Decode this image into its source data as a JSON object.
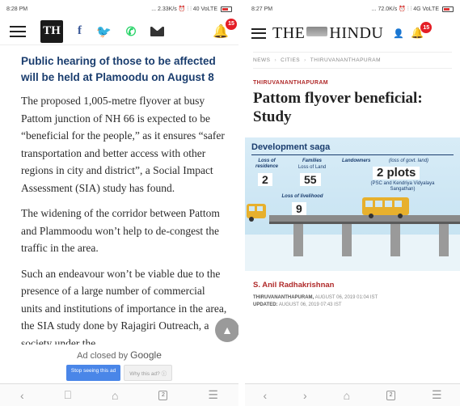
{
  "left": {
    "status": {
      "time": "8:28 PM",
      "right": "... 2.33K/s ⏰ ⫶ ⫶ 40 VoLTE"
    },
    "header": {
      "logo": "TH",
      "facebook": "f",
      "twitter": "🐦",
      "whatsapp": "✆",
      "notification_count": "15"
    },
    "headline": "Public hearing of those to be affected will be held at Plamoodu on August 8",
    "paragraphs": [
      "The proposed 1,005-metre flyover at busy Pattom junction of NH 66 is expected to be “beneficial for the people,” as it ensures “safer transportation and better access with other regions in city and district”, a Social Impact Assessment (SIA) study has found.",
      "The widening of the corridor between Pattom and Plammoodu won’t help to de-congest the traffic in the area.",
      "Such an endeavour won’t be viable due to the presence of a large number of commercial units and institutions of importance in the area, the SIA study done by Rajagiri Outreach, a society under the"
    ],
    "ad": {
      "closed_by": "Ad closed by",
      "google": "Google",
      "stop_label": "Stop seeing this ad",
      "why_label": "Why this ad? ⓘ"
    },
    "nav": {
      "back": "‹",
      "book": "⎕",
      "home": "⌂",
      "tabs": "2",
      "menu": "☰"
    }
  },
  "right": {
    "status": {
      "time": "8:27 PM",
      "right": "... 72.0K/s ⏰ ⫶ ⫶ 4G VoLTE"
    },
    "masthead_left": "THE",
    "masthead_right": "HINDU",
    "notification_count": "15",
    "breadcrumb": [
      "NEWS",
      "CITIES",
      "THIRUVANANTHAPURAM"
    ],
    "section": "THIRUVANANTHAPURAM",
    "title": "Pattom flyover beneficial: Study",
    "infographic": {
      "title": "Development saga",
      "loss_residence_label": "Loss of residence",
      "loss_residence_value": "2",
      "families_label": "Families",
      "families_sub": "Loss of Land",
      "families_value": "55",
      "landowners_label": "Landowners",
      "landowners_note": "(loss of govt. land)",
      "landowners_value": "2 plots",
      "landowners_sub": "(PSC and Kendriya Vidyalaya Sangathan)",
      "livelihood_label": "Loss of livelihood",
      "livelihood_value": "9"
    },
    "byline": "S. Anil Radhakrishnan",
    "dateline_place": "THIRUVANANTHAPURAM,",
    "dateline_date": "AUGUST 06, 2019 01:04 IST",
    "updated_label": "UPDATED:",
    "updated_date": "AUGUST 06, 2019 07:43 IST",
    "nav": {
      "back": "‹",
      "forward": "›",
      "home": "⌂",
      "tabs": "2",
      "menu": "☰"
    }
  },
  "colors": {
    "headline_blue": "#1a3d6e",
    "brand_red": "#b02a2a",
    "badge_red": "#e41e26"
  }
}
